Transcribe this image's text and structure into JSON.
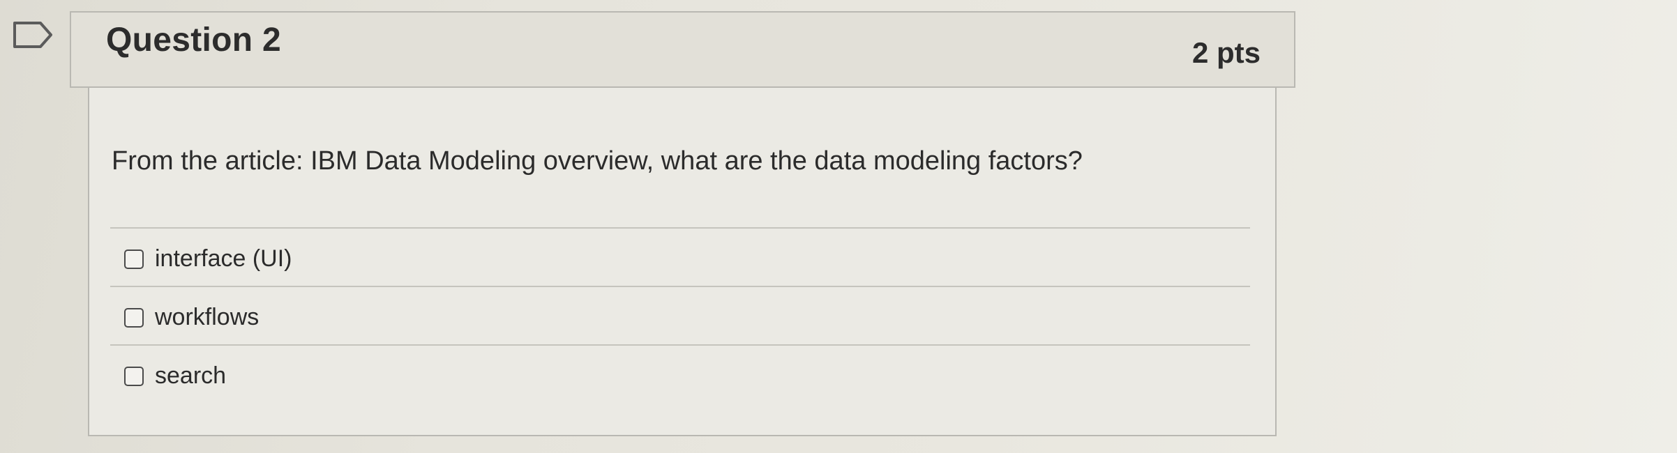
{
  "question": {
    "title": "Question 2",
    "points": "2 pts",
    "text": "From the article: IBM Data Modeling overview, what are the data modeling factors?",
    "answers": [
      {
        "label": "interface (UI)",
        "checked": false
      },
      {
        "label": "workflows",
        "checked": false
      },
      {
        "label": "search",
        "checked": false
      }
    ]
  },
  "icons": {
    "flag": "flag-icon"
  },
  "colors": {
    "header_bg": "#e2e0d8",
    "body_bg": "#ebeae4",
    "border": "#b9b8b2",
    "text": "#2b2b2b"
  }
}
